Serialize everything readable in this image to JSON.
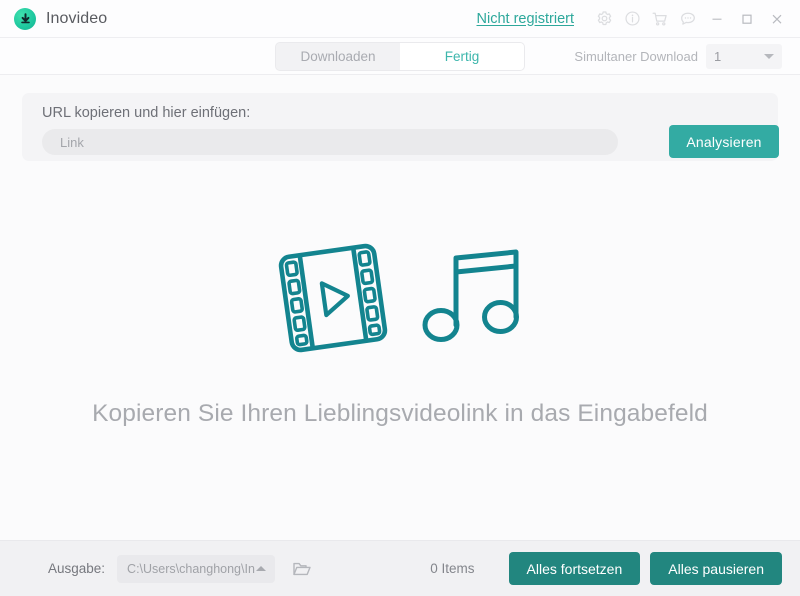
{
  "titlebar": {
    "app_name": "Inovideo",
    "logo_icon": "download-circle-logo",
    "register_link": "Nicht registriert",
    "icons": [
      {
        "name": "gear-icon",
        "label": "Einstellungen"
      },
      {
        "name": "info-icon",
        "label": "Info"
      },
      {
        "name": "cart-icon",
        "label": "Kaufen"
      },
      {
        "name": "feedback-icon",
        "label": "Feedback"
      }
    ],
    "window_controls": [
      {
        "name": "minimize-button",
        "label": "Minimieren"
      },
      {
        "name": "maximize-button",
        "label": "Maximieren"
      },
      {
        "name": "close-button",
        "label": "Schließen"
      }
    ]
  },
  "tabs": [
    {
      "label": "Downloaden",
      "active": false
    },
    {
      "label": "Fertig",
      "active": true
    }
  ],
  "simultaneous": {
    "label": "Simultaner Download",
    "value": "1"
  },
  "url_panel": {
    "label": "URL kopieren und hier einfügen:",
    "input_value": "",
    "placeholder": "Link",
    "analyze_button": "Analysieren"
  },
  "empty_state": {
    "message": "Kopieren Sie Ihren Lieblingsvideolink in das Eingabefeld",
    "art_icons": [
      "film-strip-icon",
      "music-note-icon"
    ]
  },
  "bottombar": {
    "output_label": "Ausgabe:",
    "output_path": "C:\\Users\\changhong\\In",
    "folder_icon": "folder-open-icon",
    "items_count": "0 Items",
    "resume_all": "Alles fortsetzen",
    "pause_all": "Alles pausieren"
  },
  "colors": {
    "accent": "#33aba3",
    "accent_dark": "#22867f",
    "logo_green": "#20c9a0",
    "link": "#2da89b",
    "art_teal": "#13848f",
    "muted_text": "#a8aaaf"
  }
}
